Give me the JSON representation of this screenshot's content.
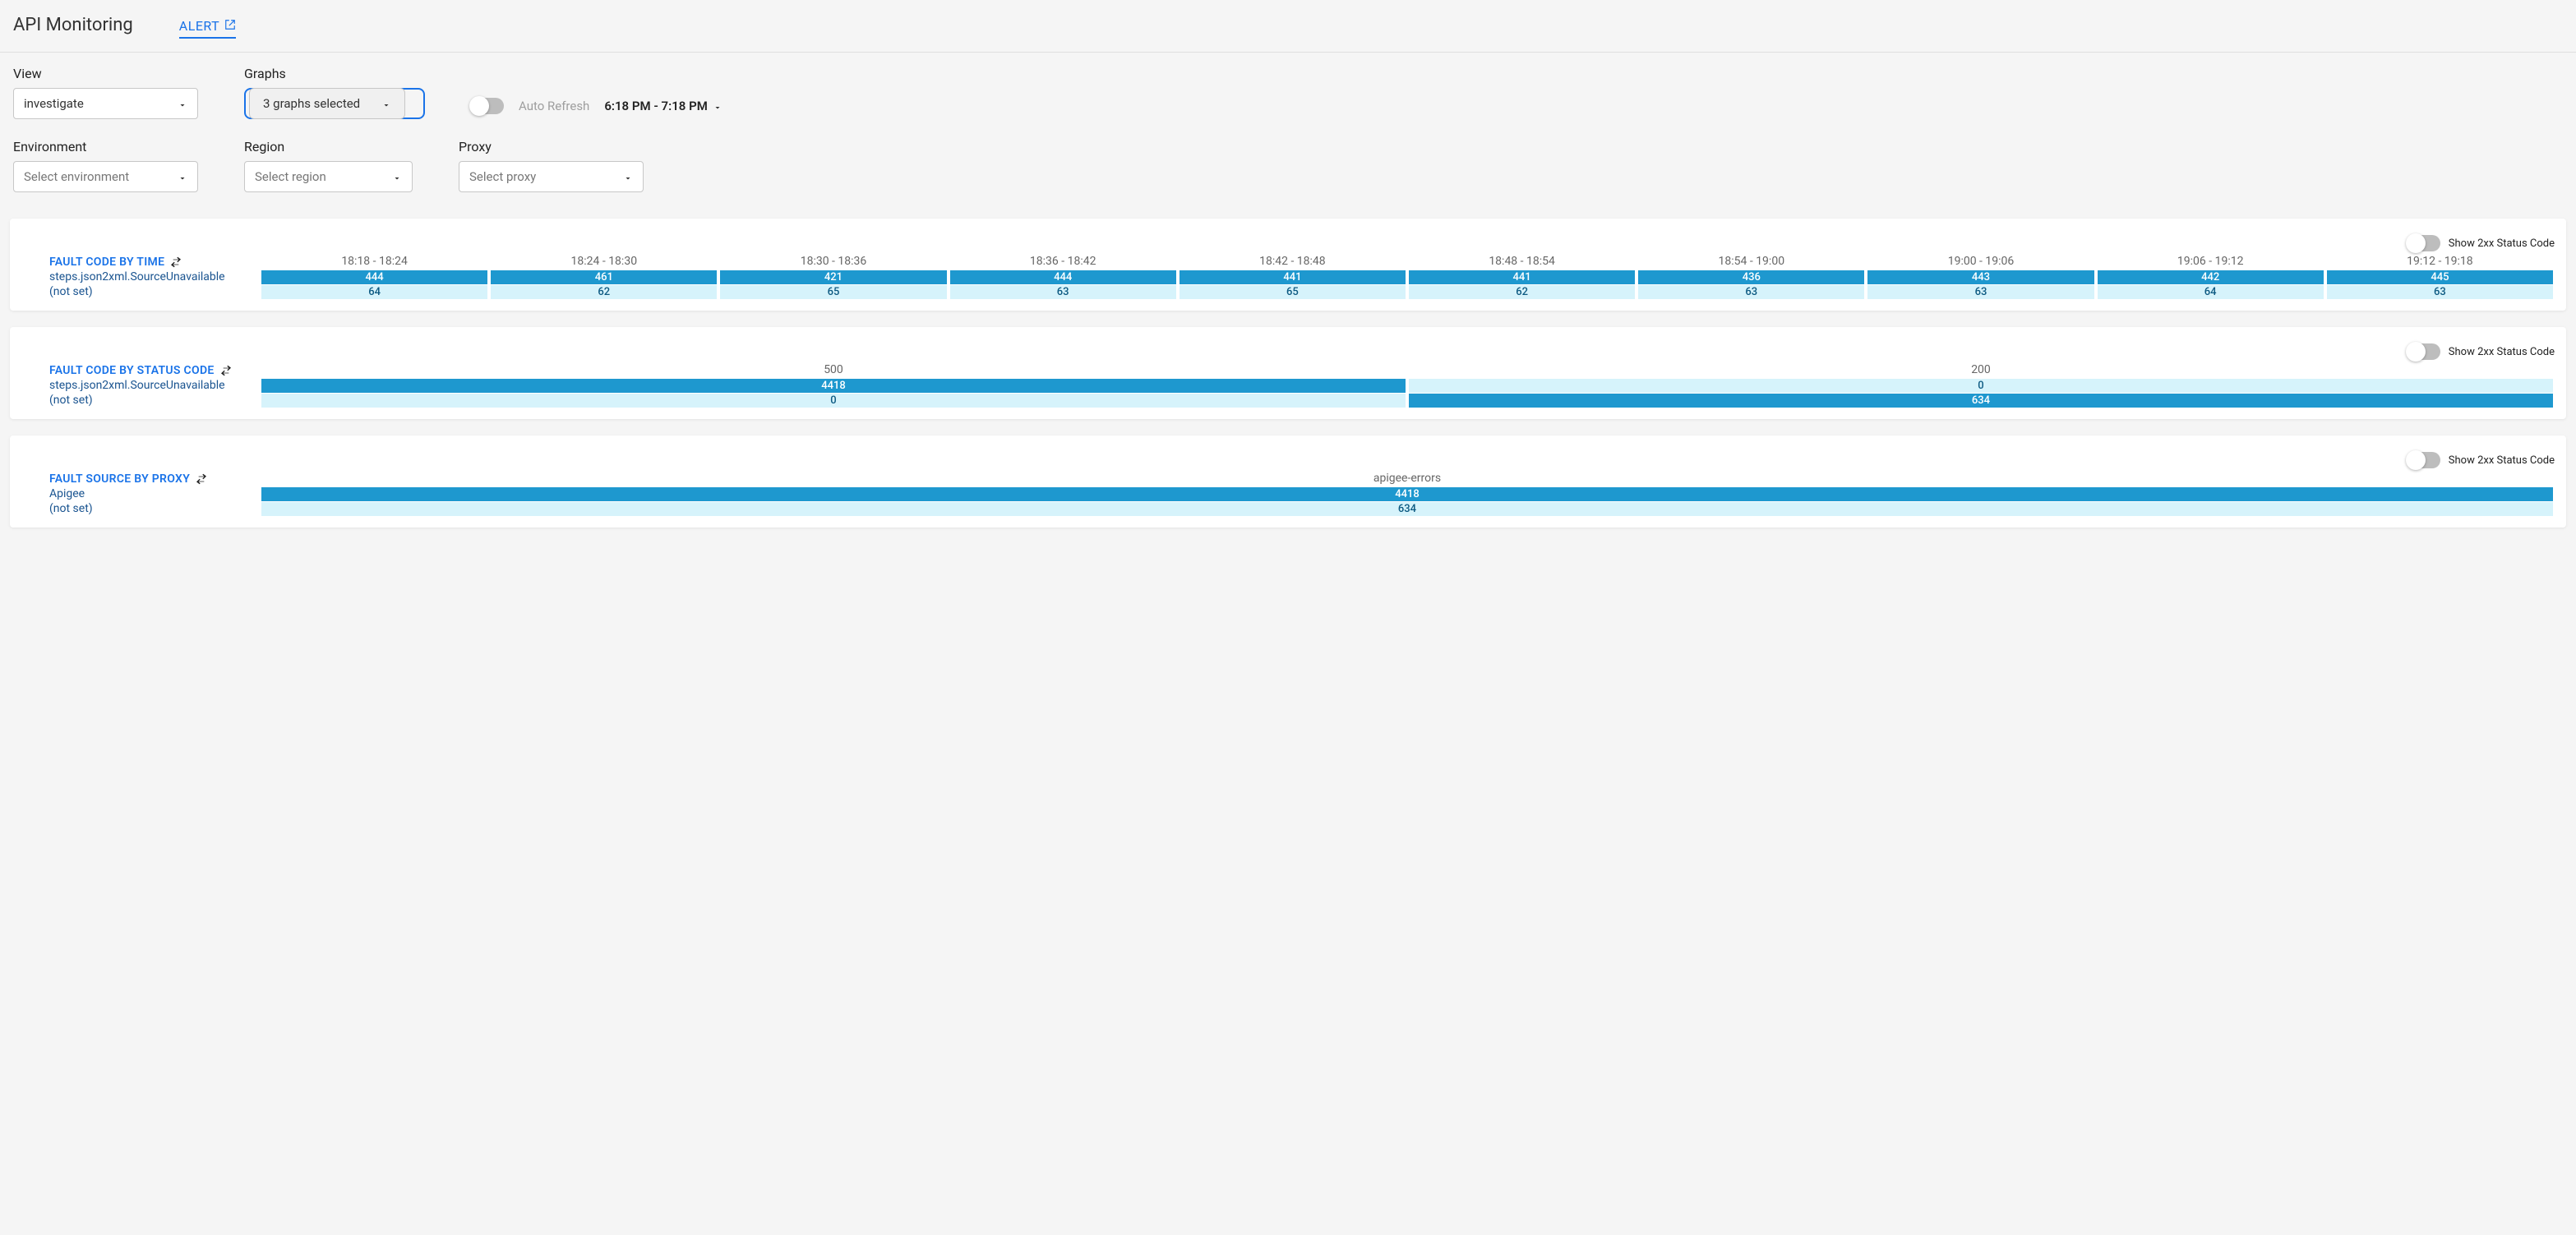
{
  "page_title": "API Monitoring",
  "alert_link": "ALERT",
  "controls": {
    "view": {
      "label": "View",
      "value": "investigate"
    },
    "graphs": {
      "label": "Graphs",
      "value": "3 graphs selected"
    },
    "auto_refresh": {
      "label": "Auto Refresh"
    },
    "time_range": {
      "label": "6:18 PM - 7:18 PM"
    },
    "environment": {
      "label": "Environment",
      "placeholder": "Select environment"
    },
    "region": {
      "label": "Region",
      "placeholder": "Select region"
    },
    "proxy": {
      "label": "Proxy",
      "placeholder": "Select proxy"
    }
  },
  "show2xx_label": "Show 2xx Status Code",
  "chart_data": [
    {
      "type": "heatmap",
      "title": "FAULT CODE BY TIME",
      "columns": [
        "18:18 - 18:24",
        "18:24 - 18:30",
        "18:30 - 18:36",
        "18:36 - 18:42",
        "18:42 - 18:48",
        "18:48 - 18:54",
        "18:54 - 19:00",
        "19:00 - 19:06",
        "19:06 - 19:12",
        "19:12 - 19:18"
      ],
      "rows": [
        {
          "label": "steps.json2xml.SourceUnavailable",
          "color": "dark",
          "values": [
            444,
            461,
            421,
            444,
            441,
            441,
            436,
            443,
            442,
            445
          ]
        },
        {
          "label": "(not set)",
          "color": "light",
          "values": [
            64,
            62,
            65,
            63,
            65,
            62,
            63,
            63,
            64,
            63
          ]
        }
      ]
    },
    {
      "type": "heatmap",
      "title": "FAULT CODE BY STATUS CODE",
      "columns": [
        "500",
        "200"
      ],
      "rows": [
        {
          "label": "steps.json2xml.SourceUnavailable",
          "values": [
            4418,
            0
          ],
          "colors": [
            "dark",
            "light"
          ]
        },
        {
          "label": "(not set)",
          "values": [
            0,
            634
          ],
          "colors": [
            "light",
            "dark"
          ]
        }
      ]
    },
    {
      "type": "heatmap",
      "title": "FAULT SOURCE BY PROXY",
      "columns": [
        "apigee-errors"
      ],
      "rows": [
        {
          "label": "Apigee",
          "color": "dark",
          "values": [
            4418
          ]
        },
        {
          "label": "(not set)",
          "color": "light",
          "values": [
            634
          ]
        }
      ]
    }
  ]
}
